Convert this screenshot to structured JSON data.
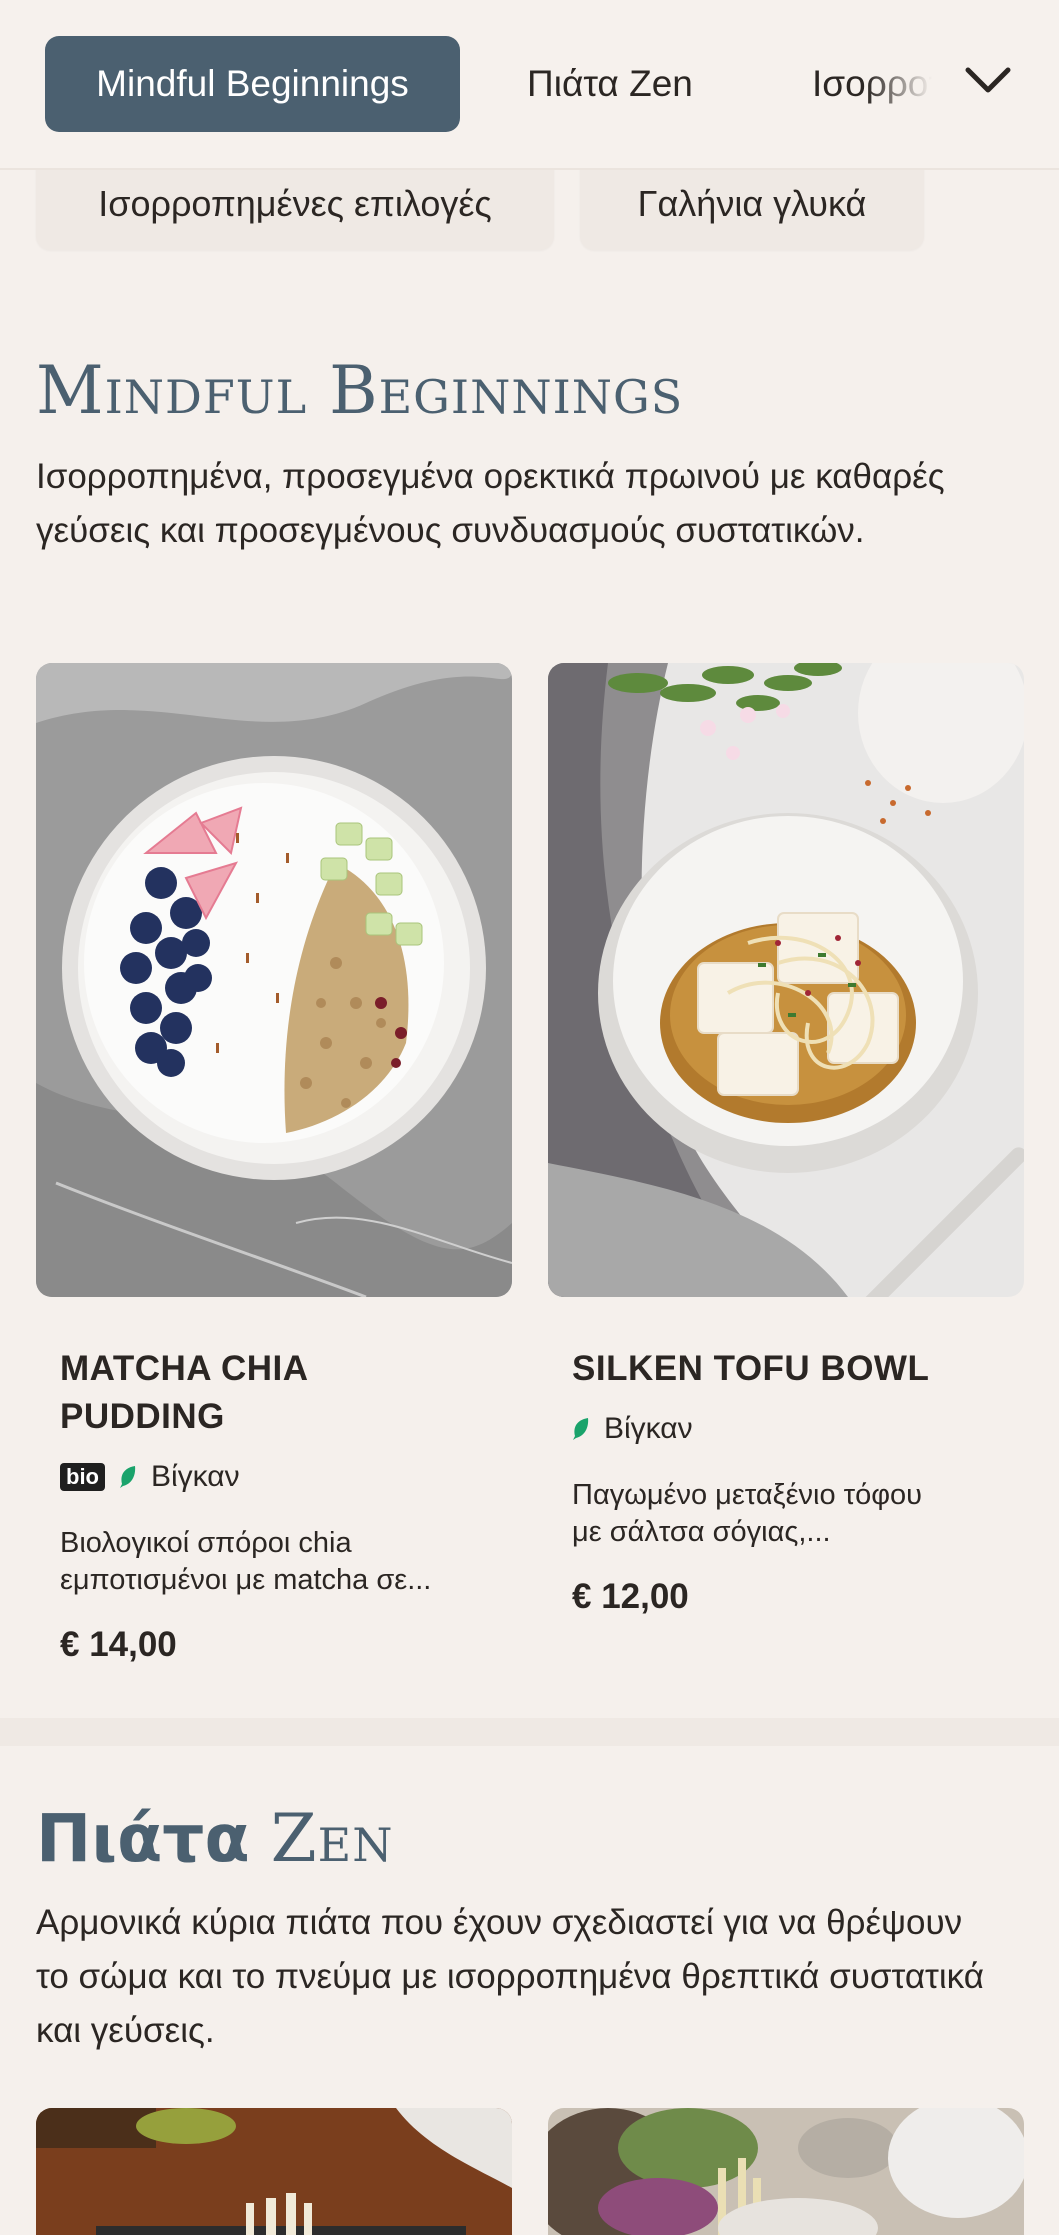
{
  "nav": {
    "tabs": [
      {
        "label": "Mindful Beginnings",
        "active": true
      },
      {
        "label": "Πιάτα Zen",
        "active": false
      },
      {
        "label": "Ισορροπημένες επιλογές",
        "active": false
      }
    ],
    "dropdown_icon": "chevron-down-icon",
    "subnav": [
      "Ισορροπημένες επιλογές",
      "Γαλήνια γλυκά"
    ]
  },
  "sections": [
    {
      "title": "Mindful Beginnings",
      "description": "Ισορροπημένα, προσεγμένα ορεκτικά πρωινού με καθαρές γεύσεις και προσεγμένους συνδυασμούς συστατικών.",
      "items": [
        {
          "name_line1": "MATCHA CHIA",
          "name_line2": "PUDDING",
          "tags": [
            "bio",
            "Βίγκαν"
          ],
          "description_line1": "Βιολογικοί σπόροι chia",
          "description_line2": "εμποτισμένοι με matcha σε...",
          "price": "€ 14,00"
        },
        {
          "name_line1": "SILKEN TOFU BOWL",
          "tags": [
            "Βίγκαν"
          ],
          "description_line1": "Παγωμένο μεταξένιο τόφου",
          "description_line2": "με σάλτσα σόγιας,...",
          "price": "€ 12,00"
        }
      ]
    },
    {
      "title_word1": "Πιάτα",
      "title_word2": "Zen",
      "description": "Αρμονικά κύρια πιάτα που έχουν σχεδιαστεί για να θρέψουν το σώμα και το πνεύμα με ισορροπημένα θρεπτικά συστατικά και γεύσεις."
    }
  ],
  "colors": {
    "accent": "#4b6070",
    "background": "#f5f0ec",
    "vegan_leaf": "#1aa36b"
  }
}
